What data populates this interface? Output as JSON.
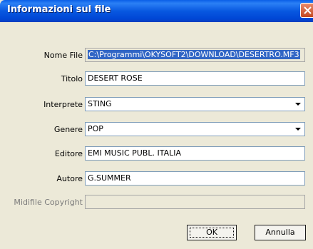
{
  "window": {
    "title": "Informazioni sul file"
  },
  "form": {
    "nome_file": {
      "label": "Nome File",
      "value": "C:\\Programmi\\OKYSOFT2\\DOWNLOAD\\DESERTRO.MF3"
    },
    "titolo": {
      "label": "Titolo",
      "value": "DESERT ROSE"
    },
    "interprete": {
      "label": "Interprete",
      "value": "STING"
    },
    "genere": {
      "label": "Genere",
      "value": "POP"
    },
    "editore": {
      "label": "Editore",
      "value": "EMI MUSIC PUBL. ITALIA"
    },
    "autore": {
      "label": "Autore",
      "value": "G.SUMMER"
    },
    "midifile_copyright": {
      "label": "Midifile Copyright",
      "value": ""
    }
  },
  "buttons": {
    "ok": "OK",
    "cancel": "Annulla"
  },
  "icons": {
    "close": "close-icon",
    "dropdown": "chevron-down-icon"
  },
  "colors": {
    "titlebar": "#0058e6",
    "dialog_bg": "#ece9d8",
    "selection": "#3166c5"
  }
}
